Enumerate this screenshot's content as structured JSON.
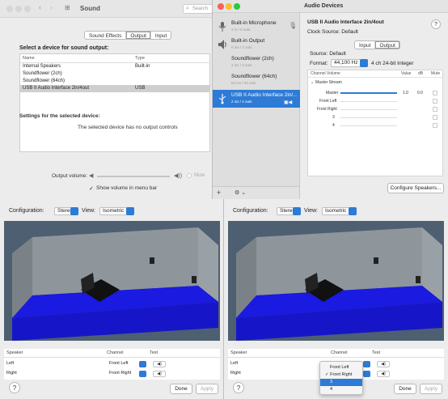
{
  "sound": {
    "title": "Sound",
    "search_placeholder": "Search",
    "tabs": [
      "Sound Effects",
      "Output",
      "Input"
    ],
    "select_heading": "Select a device for sound output:",
    "columns": [
      "Name",
      "Type"
    ],
    "devices": [
      {
        "name": "Internal Speakers",
        "type": "Built-in"
      },
      {
        "name": "Soundflower (2ch)",
        "type": ""
      },
      {
        "name": "Soundflower (64ch)",
        "type": ""
      },
      {
        "name": "USB II Audio Interface 2in/4out",
        "type": "USB"
      }
    ],
    "settings_heading": "Settings for the selected device:",
    "no_controls": "The selected device has no output controls",
    "output_volume_label": "Output volume:",
    "mute_label": "Mute",
    "show_volume_label": "Show volume in menu bar",
    "show_volume_checked": true
  },
  "audio_devices": {
    "title": "Audio Devices",
    "sidebar": [
      {
        "name": "Built-in Microphone",
        "sub": "2 in / 0 outs",
        "icon": "microphone-icon"
      },
      {
        "name": "Built-in Output",
        "sub": "0 ins / 2 outs",
        "icon": "speaker-icon"
      },
      {
        "name": "Soundflower (2ch)",
        "sub": "2 ins / 2 outs",
        "icon": ""
      },
      {
        "name": "Soundflower (64ch)",
        "sub": "64 ins / 64 outs",
        "icon": ""
      },
      {
        "name": "USB II Audio Interface 2in/...",
        "sub": "2 ins / 4 outs",
        "icon": "usb-icon"
      }
    ],
    "device_title": "USB II Audio Interface 2in/4out",
    "clock_source": "Clock Source:  Default",
    "help": "?",
    "io_tabs": [
      "Input",
      "Output"
    ],
    "source": "Source:  Default",
    "format_label": "Format:",
    "format_rate": "44,100 Hz",
    "format_detail": "4 ch 24-bit Integer",
    "volume_headers": [
      "Channel Volume",
      "Value",
      "dB",
      "Mute"
    ],
    "master_stream": "Master Stream",
    "channels": [
      "Master",
      "Front Left",
      "Front Right",
      "3",
      "4"
    ],
    "master_value": "1.0",
    "master_db": "0.0",
    "master_volume_fraction": 1.0,
    "configure_button": "Configure Speakers...",
    "add_button": "+",
    "gear_button": "⚙ ⌄"
  },
  "config_left": {
    "configuration_label": "Configuration:",
    "configuration_value": "Stereo",
    "view_label": "View:",
    "view_value": "Isometric",
    "headers": [
      "Speaker",
      "Channel",
      "Test"
    ],
    "rows": [
      {
        "speaker": "Left",
        "channel": "Front Left"
      },
      {
        "speaker": "Right",
        "channel": "Front Right"
      }
    ],
    "help": "?",
    "done": "Done",
    "apply": "Apply"
  },
  "config_right": {
    "configuration_label": "Configuration:",
    "configuration_value": "Stereo",
    "view_label": "View:",
    "view_value": "Isometric",
    "headers": [
      "Speaker",
      "Channel",
      "Test"
    ],
    "rows": [
      {
        "speaker": "Left",
        "channel": ""
      },
      {
        "speaker": "Right",
        "channel": ""
      }
    ],
    "menu": [
      "Front Left",
      "✓ Front Right",
      "3",
      "4"
    ],
    "menu_highlight_index": 2,
    "help": "?",
    "done": "Done",
    "apply": "Apply"
  },
  "colors": {
    "accent": "#2d7bd6",
    "floor": "#1a1ae0",
    "wall": "#8e969c"
  }
}
